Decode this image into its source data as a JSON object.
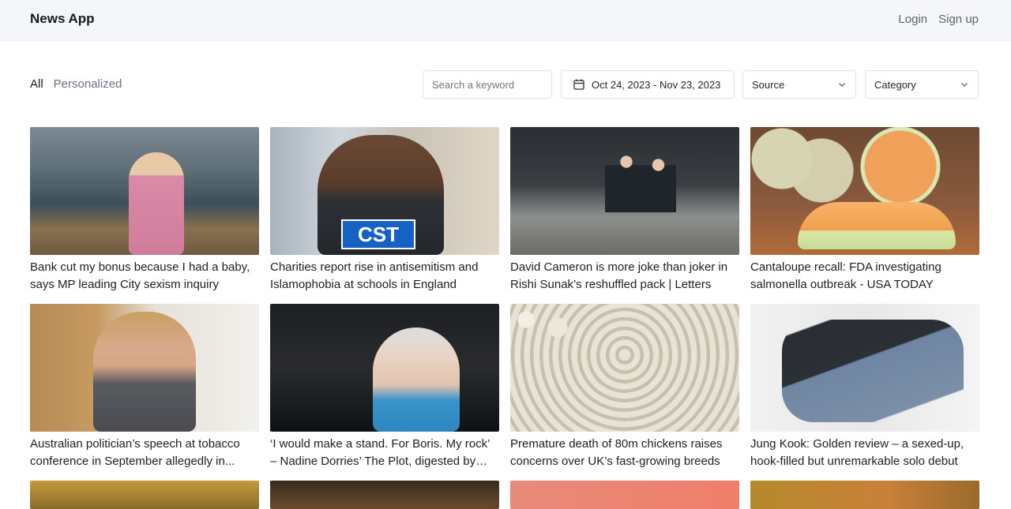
{
  "app": {
    "title": "News App"
  },
  "auth": {
    "login_label": "Login",
    "signup_label": "Sign up"
  },
  "filters": {
    "tabs": [
      {
        "label": "All",
        "active": true
      },
      {
        "label": "Personalized",
        "active": false
      }
    ],
    "search": {
      "placeholder": "Search a keyword",
      "value": ""
    },
    "date_range": {
      "icon": "calendar-icon",
      "label": "Oct 24, 2023 - Nov 23, 2023"
    },
    "source_select": {
      "label": "Source",
      "icon": "chevron-down-icon"
    },
    "category_select": {
      "label": "Category",
      "icon": "chevron-down-icon"
    }
  },
  "articles": [
    {
      "title": "Bank cut my bonus because I had a baby, says MP leading City sexism inquiry"
    },
    {
      "title": "Charities report rise in antisemitism and Islamophobia at schools in England"
    },
    {
      "title": "David Cameron is more joke than joker in Rishi Sunak’s reshuffled pack | Letters"
    },
    {
      "title": "Cantaloupe recall: FDA investigating salmonella outbreak - USA TODAY"
    },
    {
      "title": "Australian politician’s speech at tobacco conference in September allegedly in..."
    },
    {
      "title": "‘I would make a stand. For Boris. My rock’ – Nadine Dorries’ The Plot, digested by Joh..."
    },
    {
      "title": "Premature death of 80m chickens raises concerns over UK’s fast-growing breeds"
    },
    {
      "title": "Jung Kook: Golden review – a sexed-up, hook-filled but unremarkable solo debut"
    },
    {
      "title": ""
    },
    {
      "title": ""
    },
    {
      "title": ""
    },
    {
      "title": ""
    }
  ]
}
